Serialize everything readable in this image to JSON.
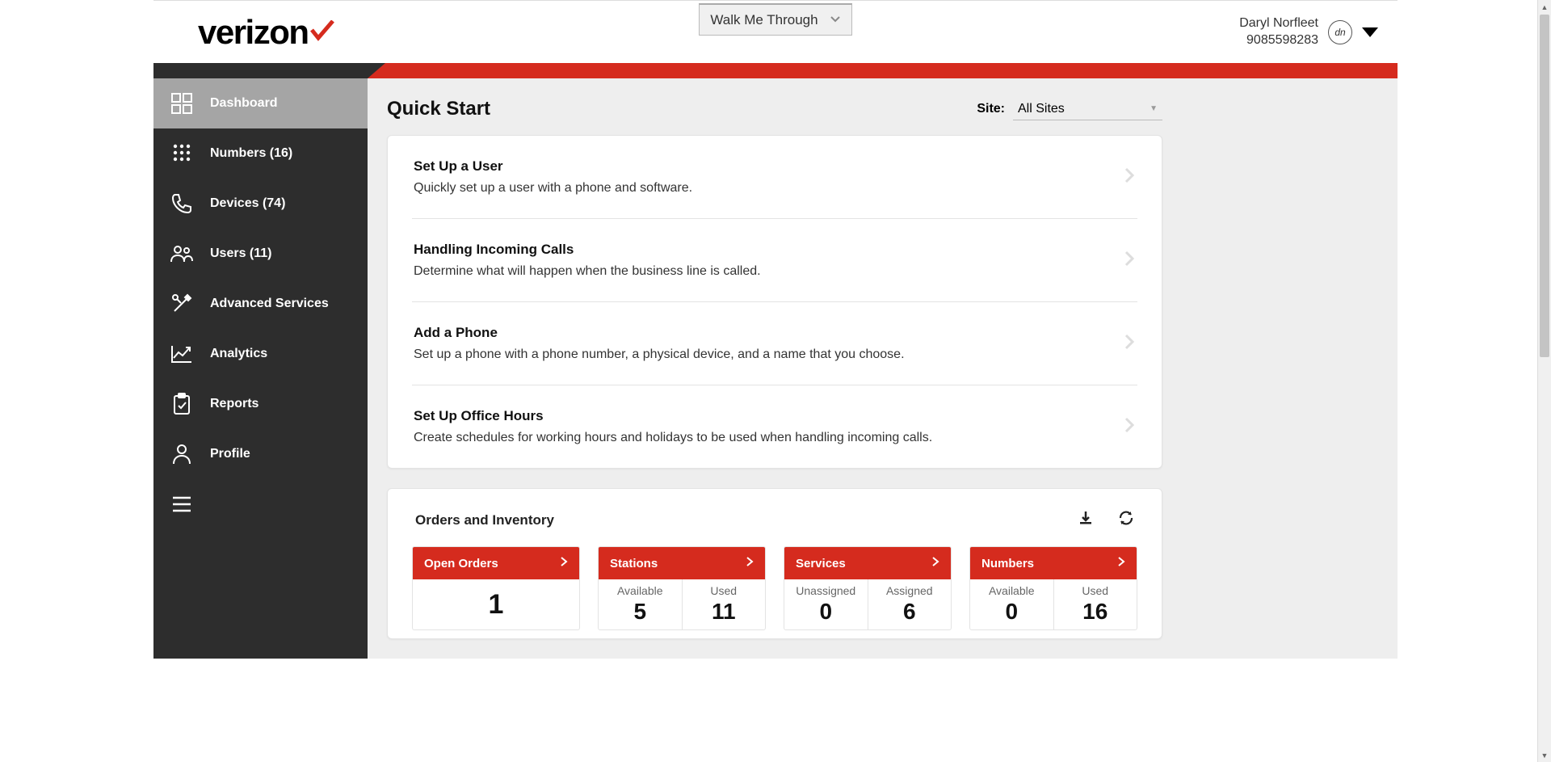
{
  "header": {
    "logo_text": "verizon",
    "walkme_label": "Walk Me Through",
    "user_name": "Daryl Norfleet",
    "user_number": "9085598283",
    "user_initials": "dn"
  },
  "sidebar": {
    "items": [
      {
        "label": "Dashboard"
      },
      {
        "label": "Numbers (16)"
      },
      {
        "label": "Devices (74)"
      },
      {
        "label": "Users (11)"
      },
      {
        "label": "Advanced Services"
      },
      {
        "label": "Analytics"
      },
      {
        "label": "Reports"
      },
      {
        "label": "Profile"
      }
    ]
  },
  "quickstart": {
    "title": "Quick Start",
    "site_label": "Site:",
    "site_selected": "All Sites",
    "items": [
      {
        "title": "Set Up a User",
        "desc": "Quickly set up a user with a phone and software."
      },
      {
        "title": "Handling Incoming Calls",
        "desc": "Determine what will happen when the business line is called."
      },
      {
        "title": "Add a Phone",
        "desc": "Set up a phone with a phone number, a physical device, and a name that you choose."
      },
      {
        "title": "Set Up Office Hours",
        "desc": "Create schedules for working hours and holidays to be used when handling incoming calls."
      }
    ]
  },
  "orders": {
    "title": "Orders and Inventory",
    "tiles": [
      {
        "title": "Open Orders",
        "single": "1"
      },
      {
        "title": "Stations",
        "a_label": "Available",
        "a_value": "5",
        "b_label": "Used",
        "b_value": "11"
      },
      {
        "title": "Services",
        "a_label": "Unassigned",
        "a_value": "0",
        "b_label": "Assigned",
        "b_value": "6"
      },
      {
        "title": "Numbers",
        "a_label": "Available",
        "a_value": "0",
        "b_label": "Used",
        "b_value": "16"
      }
    ]
  }
}
